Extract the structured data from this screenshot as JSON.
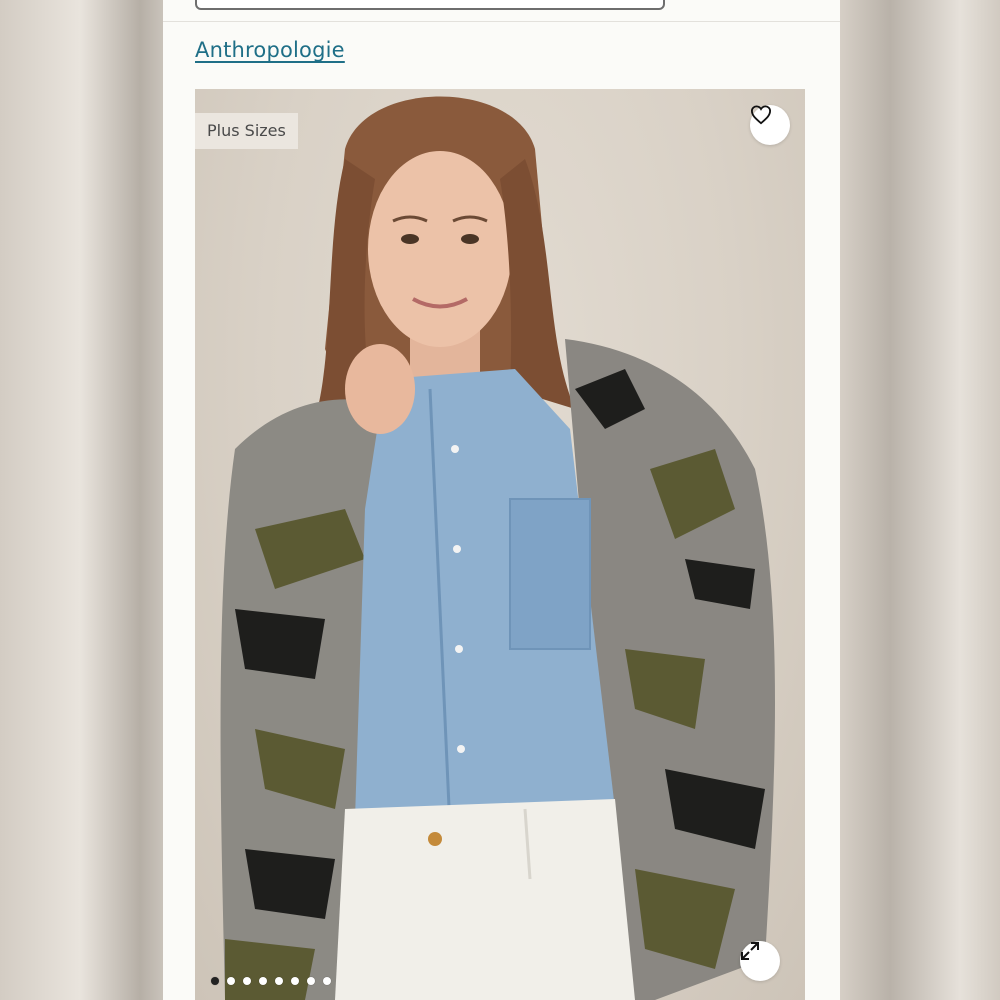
{
  "header": {
    "brand_link": "Anthropologie"
  },
  "product": {
    "badge": "Plus Sizes",
    "favorite_icon": "heart-icon",
    "expand_icon": "expand-arrows-icon",
    "image_count": 8,
    "active_image": 1
  },
  "colors": {
    "link": "#1f6f87",
    "panel": "#fbfbf8",
    "active_dot": "#222222"
  }
}
